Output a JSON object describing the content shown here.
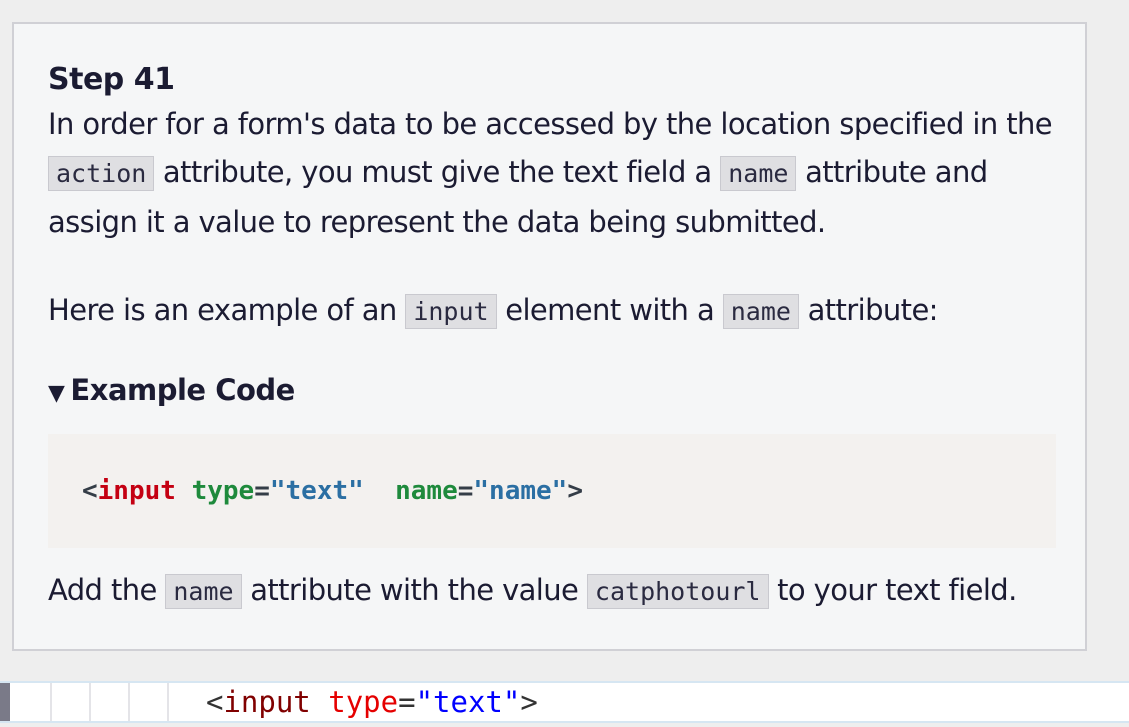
{
  "step": {
    "title": "Step 41",
    "para1": {
      "t1": "In order for a form's data to be accessed by the location specified in the",
      "c1": "action",
      "t2": " attribute, you must give the text field a ",
      "c2": "name",
      "t3": " attribute and assign it a value to represent the data being submitted."
    },
    "para2": {
      "t1": "Here is an example of an ",
      "c1": "input",
      "t2": " element with a ",
      "c2": "name",
      "t3": " attribute:"
    },
    "details_label": "Example Code",
    "example_code": {
      "open": "<",
      "tag": "input",
      "attr1": "type",
      "eq1": "=",
      "val1": "\"text\"",
      "attr2": "name",
      "eq2": "=",
      "val2": "\"name\"",
      "close": ">"
    },
    "para3": {
      "t1": "Add the ",
      "c1": "name",
      "t2": " attribute with the value ",
      "c2": "catphotourl",
      "t3": " to your text field."
    }
  },
  "editor": {
    "open": "<",
    "tag": "input",
    "attr": "type",
    "eq": "=",
    "val": "\"text\"",
    "close": ">"
  }
}
